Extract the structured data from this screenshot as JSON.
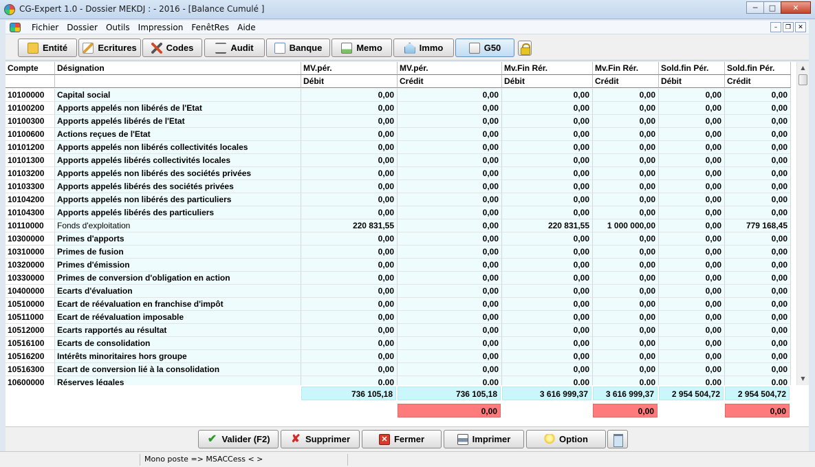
{
  "window": {
    "title": "CG-Expert 1.0 - Dossier MEKDJ :  - 2016 - [Balance Cumulé ]"
  },
  "menu": [
    "Fichier",
    "Dossier",
    "Outils",
    "Impression",
    "FenêtRes",
    "Aide"
  ],
  "toolbar": [
    {
      "label": "Entité",
      "icon": "folder-icon",
      "active": false
    },
    {
      "label": "Ecritures",
      "icon": "pencil-icon",
      "active": false
    },
    {
      "label": "Codes",
      "icon": "tools-icon",
      "active": false
    },
    {
      "label": "Audit",
      "icon": "scale-icon",
      "active": false
    },
    {
      "label": "Banque",
      "icon": "document-icon",
      "active": false
    },
    {
      "label": "Memo",
      "icon": "memo-icon",
      "active": false
    },
    {
      "label": "Immo",
      "icon": "house-icon",
      "active": false
    },
    {
      "label": "G50",
      "icon": "calculator-icon",
      "active": true
    }
  ],
  "table": {
    "headers_top": [
      "Compte",
      "Désignation",
      "MV.pér.",
      "MV.pér.",
      "Mv.Fin Rér.",
      "Mv.Fin Rér.",
      "Sold.fin Pér.",
      "Sold.fin Pér."
    ],
    "headers_sub": [
      "",
      "",
      "Débit",
      "Crédit",
      "Débit",
      "Crédit",
      "Débit",
      "Crédit"
    ],
    "rows": [
      [
        "10100000",
        "Capital social",
        "0,00",
        "0,00",
        "0,00",
        "0,00",
        "0,00",
        "0,00"
      ],
      [
        "10100200",
        "Apports appelés non libérés de l'Etat",
        "0,00",
        "0,00",
        "0,00",
        "0,00",
        "0,00",
        "0,00"
      ],
      [
        "10100300",
        "Apports appelés libérés de l'Etat",
        "0,00",
        "0,00",
        "0,00",
        "0,00",
        "0,00",
        "0,00"
      ],
      [
        "10100600",
        "Actions reçues de l'Etat",
        "0,00",
        "0,00",
        "0,00",
        "0,00",
        "0,00",
        "0,00"
      ],
      [
        "10101200",
        "Apports appelés non libérés collectivités locales",
        "0,00",
        "0,00",
        "0,00",
        "0,00",
        "0,00",
        "0,00"
      ],
      [
        "10101300",
        "Apports appelés libérés collectivités locales",
        "0,00",
        "0,00",
        "0,00",
        "0,00",
        "0,00",
        "0,00"
      ],
      [
        "10103200",
        "Apports appelés non libérés des sociétés privées",
        "0,00",
        "0,00",
        "0,00",
        "0,00",
        "0,00",
        "0,00"
      ],
      [
        "10103300",
        "Apports appelés libérés des sociétés privées",
        "0,00",
        "0,00",
        "0,00",
        "0,00",
        "0,00",
        "0,00"
      ],
      [
        "10104200",
        "Apports appelés non libérés des particuliers",
        "0,00",
        "0,00",
        "0,00",
        "0,00",
        "0,00",
        "0,00"
      ],
      [
        "10104300",
        "Apports appelés libérés des particuliers",
        "0,00",
        "0,00",
        "0,00",
        "0,00",
        "0,00",
        "0,00"
      ],
      [
        "10110000",
        "Fonds d'exploitation",
        "220 831,55",
        "0,00",
        "220 831,55",
        "1 000 000,00",
        "0,00",
        "779 168,45"
      ],
      [
        "10300000",
        "Primes d'apports",
        "0,00",
        "0,00",
        "0,00",
        "0,00",
        "0,00",
        "0,00"
      ],
      [
        "10310000",
        "Primes de fusion",
        "0,00",
        "0,00",
        "0,00",
        "0,00",
        "0,00",
        "0,00"
      ],
      [
        "10320000",
        "Primes d'émission",
        "0,00",
        "0,00",
        "0,00",
        "0,00",
        "0,00",
        "0,00"
      ],
      [
        "10330000",
        "Primes de conversion d'obligation en action",
        "0,00",
        "0,00",
        "0,00",
        "0,00",
        "0,00",
        "0,00"
      ],
      [
        "10400000",
        "Ecarts d'évaluation",
        "0,00",
        "0,00",
        "0,00",
        "0,00",
        "0,00",
        "0,00"
      ],
      [
        "10510000",
        "Ecart de réévaluation en franchise d'impôt",
        "0,00",
        "0,00",
        "0,00",
        "0,00",
        "0,00",
        "0,00"
      ],
      [
        "10511000",
        "Ecart de réévaluation imposable",
        "0,00",
        "0,00",
        "0,00",
        "0,00",
        "0,00",
        "0,00"
      ],
      [
        "10512000",
        "Ecarts rapportés au résultat",
        "0,00",
        "0,00",
        "0,00",
        "0,00",
        "0,00",
        "0,00"
      ],
      [
        "10516100",
        "Ecarts de consolidation",
        "0,00",
        "0,00",
        "0,00",
        "0,00",
        "0,00",
        "0,00"
      ],
      [
        "10516200",
        "Intérêts minoritaires hors groupe",
        "0,00",
        "0,00",
        "0,00",
        "0,00",
        "0,00",
        "0,00"
      ],
      [
        "10516300",
        "Ecart de conversion lié à la consolidation",
        "0,00",
        "0,00",
        "0,00",
        "0,00",
        "0,00",
        "0,00"
      ],
      [
        "10600000",
        "Réserves légales",
        "0,00",
        "0,00",
        "0,00",
        "0,00",
        "0,00",
        "0,00"
      ]
    ]
  },
  "totals": {
    "sums": [
      "736 105,18",
      "736 105,18",
      "3 616 999,37",
      "3 616 999,37",
      "2 954 504,72",
      "2 954 504,72"
    ],
    "diffs": [
      "0,00",
      "0,00",
      "0,00"
    ]
  },
  "bottom_buttons": [
    {
      "label": "Valider (F2)",
      "icon": "checkmark-icon"
    },
    {
      "label": "Supprimer",
      "icon": "cross-icon"
    },
    {
      "label": "Fermer",
      "icon": "close-box-icon"
    },
    {
      "label": "Imprimer",
      "icon": "printer-icon"
    },
    {
      "label": "Option",
      "icon": "lightbulb-icon"
    }
  ],
  "status": {
    "mode": "Mono poste => MSACCess <  >"
  },
  "colors": {
    "row_bg": "#effcfd",
    "total_bg": "#c9f7fc",
    "diff_bg": "#ff7b7b"
  }
}
